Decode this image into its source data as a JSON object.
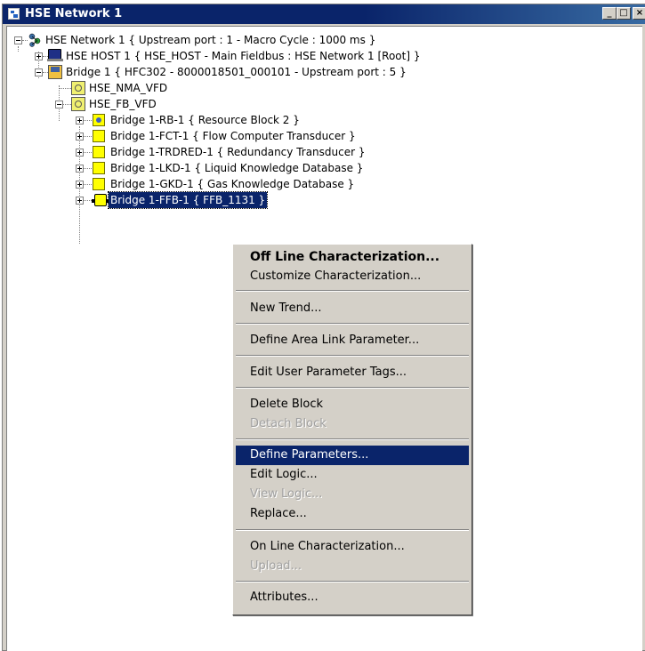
{
  "window": {
    "title": "HSE Network 1",
    "buttons": {
      "minimize": "_",
      "maximize": "□",
      "close": "×"
    }
  },
  "tree": {
    "root": "HSE Network 1 { Upstream port : 1 -  Macro Cycle : 1000 ms  }",
    "host": "HSE HOST 1 { HSE_HOST -  Main Fieldbus : HSE Network 1 [Root] }",
    "bridge": "Bridge 1 { HFC302 - 8000018501_000101 -  Upstream port : 5 }",
    "nma_vfd": "HSE_NMA_VFD",
    "fb_vfd": "HSE_FB_VFD",
    "blocks": [
      "Bridge 1-RB-1 { Resource Block 2 }",
      "Bridge 1-FCT-1 { Flow Computer Transducer }",
      "Bridge 1-TRDRED-1 { Redundancy Transducer }",
      "Bridge 1-LKD-1 { Liquid Knowledge Database }",
      "Bridge 1-GKD-1 { Gas Knowledge Database }",
      "Bridge 1-FFB-1 { FFB_1131 }"
    ]
  },
  "context_menu": {
    "items": [
      "Off Line Characterization...",
      "Customize Characterization...",
      "New Trend...",
      "Define Area Link Parameter...",
      "Edit User Parameter Tags...",
      "Delete Block",
      "Detach Block",
      "Define Parameters...",
      "Edit Logic...",
      "View Logic...",
      "Replace...",
      "On Line Characterization...",
      "Upload...",
      "Attributes..."
    ]
  },
  "colors": {
    "title_bar": "#0a246a",
    "selection": "#0a246a",
    "window_face": "#d4d0c8",
    "block_icon": "#ffff00"
  },
  "icons": {
    "root": "network-icon",
    "host": "computer-icon",
    "bridge": "bridge-device-icon",
    "vfd": "vfd-icon",
    "block": "function-block-icon",
    "ffb": "flexible-function-block-icon"
  }
}
